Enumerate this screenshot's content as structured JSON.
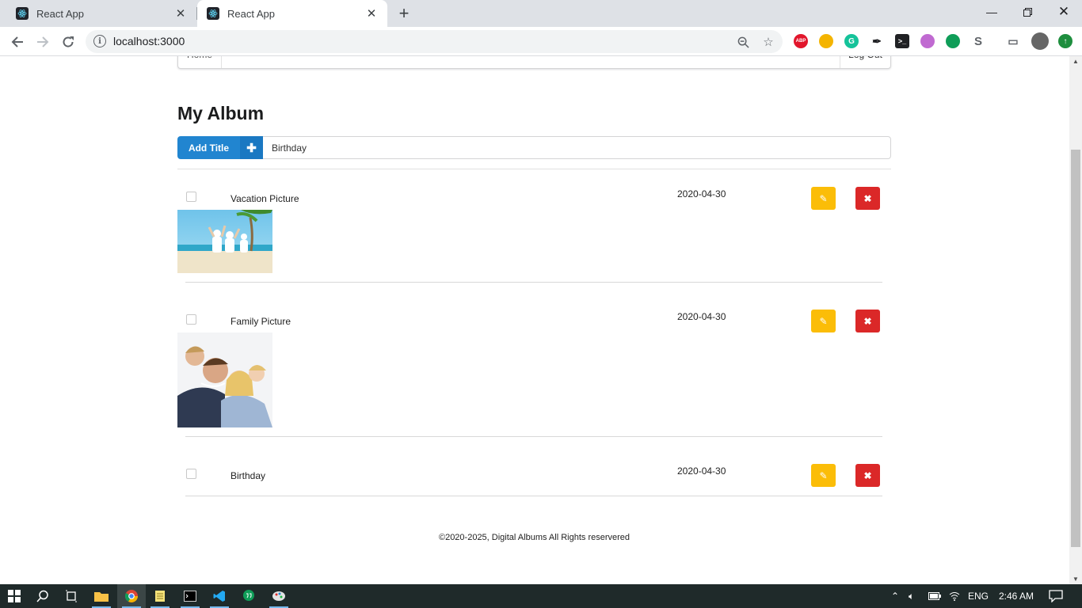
{
  "browser": {
    "tabs": [
      {
        "title": "React App",
        "active": false
      },
      {
        "title": "React App",
        "active": true
      }
    ],
    "new_tab_icon": "plus-icon",
    "url": "localhost:3000",
    "extensions": [
      "ABP"
    ],
    "window_controls": [
      "minimize-icon",
      "restore-icon",
      "close-icon"
    ]
  },
  "menu": {
    "home_label": "Home",
    "logout_label": "Log Out"
  },
  "page": {
    "title": "My Album",
    "add_button_label": "Add Title",
    "add_input_value": "Birthday"
  },
  "items": [
    {
      "name": "Vacation Picture",
      "date": "2020-04-30",
      "photo": "beach"
    },
    {
      "name": "Family Picture",
      "date": "2020-04-30",
      "photo": "family"
    },
    {
      "name": "Birthday",
      "date": "2020-04-30",
      "photo": ""
    }
  ],
  "footer": {
    "text": "©2020-2025, Digital Albums All Rights reservered"
  },
  "taskbar": {
    "language": "ENG",
    "time": "2:46 AM"
  },
  "colors": {
    "primary": "#2185d0",
    "edit": "#fbbd08",
    "delete": "#db2828"
  }
}
